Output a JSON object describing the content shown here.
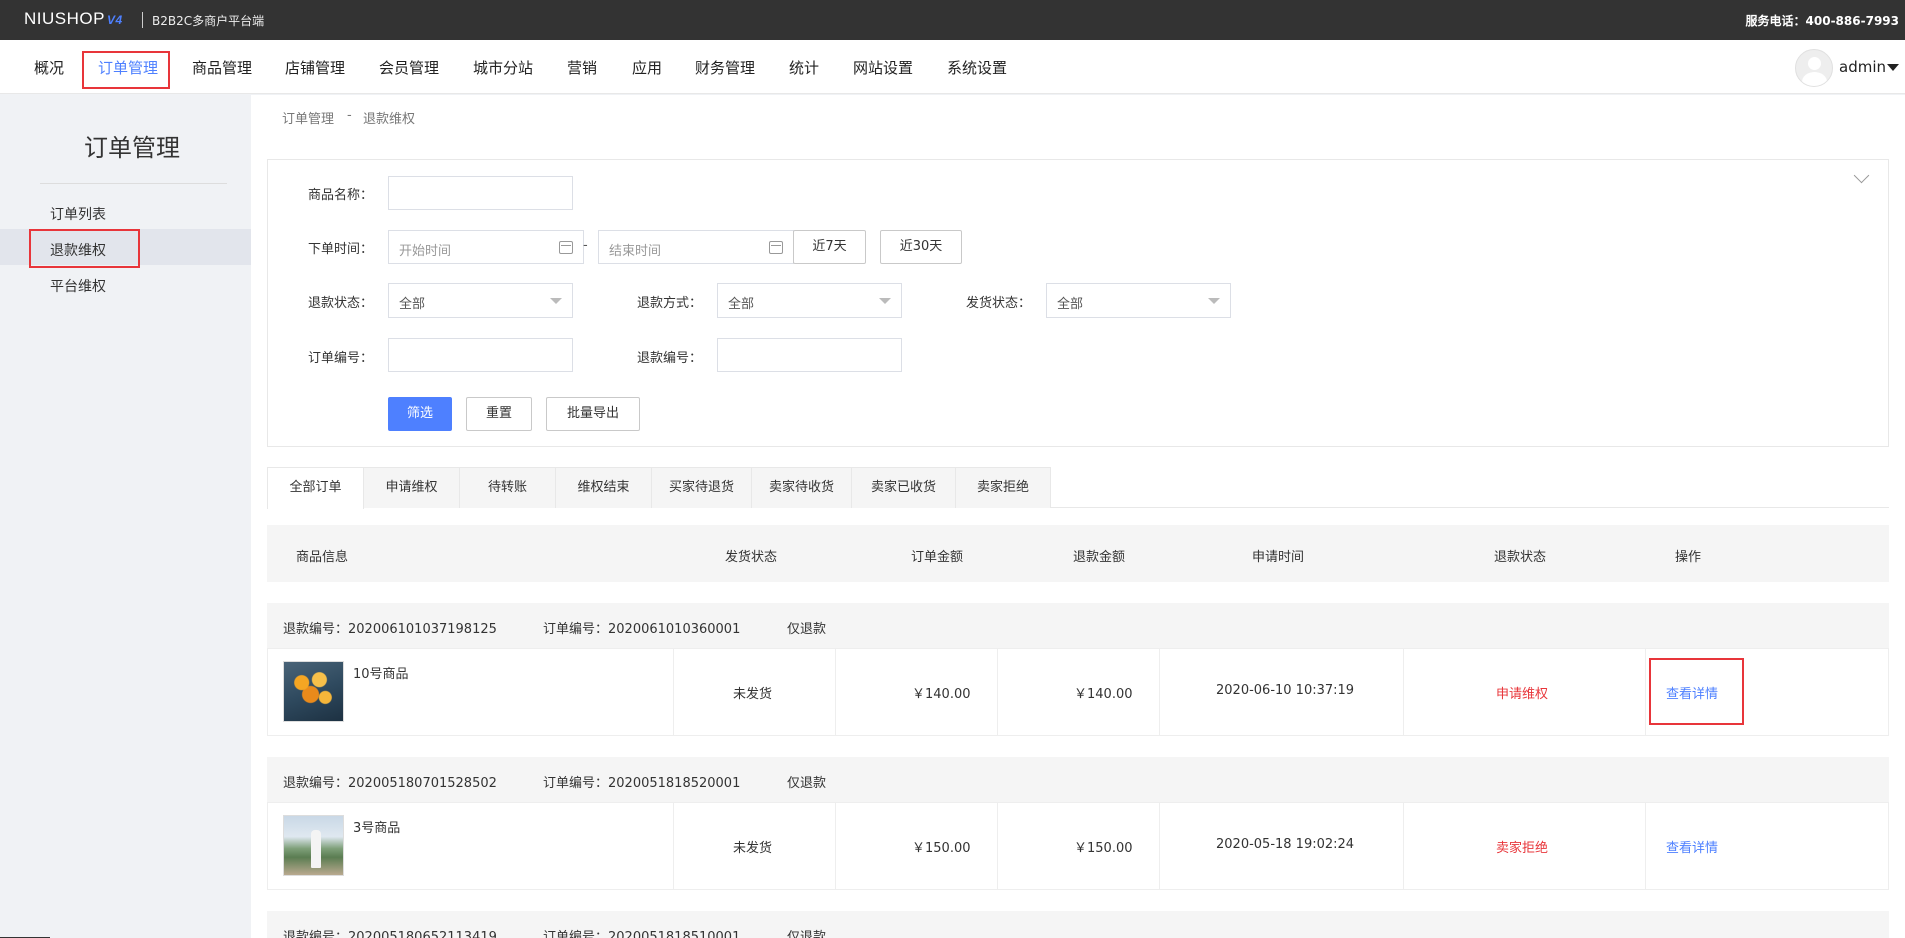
{
  "topbar": {
    "logo": "NIUSHOP",
    "logo_version": "V4",
    "subtitle": "B2B2C多商户平台端",
    "service": "服务电话：400-886-7993"
  },
  "nav": {
    "items": [
      "概况",
      "订单管理",
      "商品管理",
      "店铺管理",
      "会员管理",
      "城市分站",
      "营销",
      "应用",
      "财务管理",
      "统计",
      "网站设置",
      "系统设置"
    ],
    "active_index": 1,
    "user": "admin"
  },
  "sidebar": {
    "title": "订单管理",
    "items": [
      "订单列表",
      "退款维权",
      "平台维权"
    ],
    "active_index": 1
  },
  "breadcrumb": [
    "订单管理",
    "-",
    "退款维权"
  ],
  "filter": {
    "goods_name_label": "商品名称：",
    "order_time_label": "下单时间：",
    "start_placeholder": "开始时间",
    "date_sep": "-",
    "end_placeholder": "结束时间",
    "btn_7days": "近7天",
    "btn_30days": "近30天",
    "refund_status_label": "退款状态：",
    "refund_status_value": "全部",
    "refund_method_label": "退款方式：",
    "refund_method_value": "全部",
    "ship_status_label": "发货状态：",
    "ship_status_value": "全部",
    "order_no_label": "订单编号：",
    "refund_no_label": "退款编号：",
    "btn_filter": "筛选",
    "btn_reset": "重置",
    "btn_export": "批量导出"
  },
  "tabs": [
    "全部订单",
    "申请维权",
    "待转账",
    "维权结束",
    "买家待退货",
    "卖家待收货",
    "卖家已收货",
    "卖家拒绝"
  ],
  "table": {
    "headers": [
      "商品信息",
      "发货状态",
      "订单金额",
      "退款金额",
      "申请时间",
      "退款状态",
      "操作"
    ],
    "rows": [
      {
        "refund_no": "退款编号：202006101037198125",
        "order_no": "订单编号：2020061010360001",
        "type": "仅退款",
        "goods": "10号商品",
        "ship": "未发货",
        "order_amount": "￥140.00",
        "refund_amount": "￥140.00",
        "time": "2020-06-10 10:37:19",
        "status": "申请维权",
        "action": "查看详情"
      },
      {
        "refund_no": "退款编号：202005180701528502",
        "order_no": "订单编号：2020051818520001",
        "type": "仅退款",
        "goods": "3号商品",
        "ship": "未发货",
        "order_amount": "￥150.00",
        "refund_amount": "￥150.00",
        "time": "2020-05-18 19:02:24",
        "status": "卖家拒绝",
        "action": "查看详情"
      },
      {
        "refund_no": "退款编号：202005180652113419",
        "order_no": "订单编号：2020051818510001",
        "type": "仅退款"
      }
    ]
  },
  "colors": {
    "accent": "#4e80ff",
    "status_red": "#e8353a",
    "topbar_bg": "#333333"
  }
}
